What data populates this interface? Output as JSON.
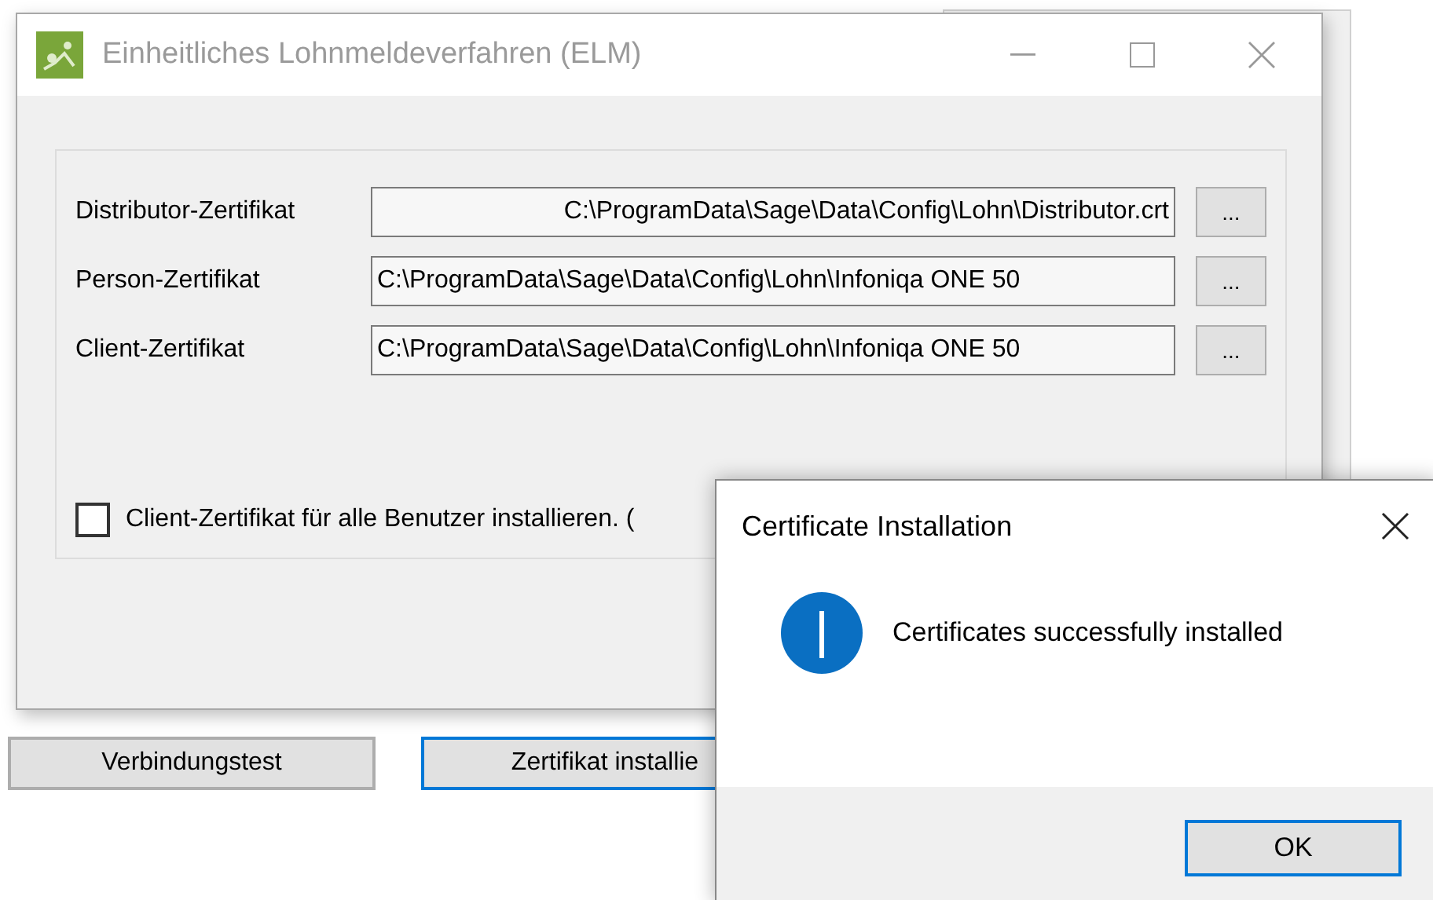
{
  "main_window": {
    "title": "Einheitliches Lohnmeldeverfahren (ELM)",
    "certificates": [
      {
        "label": "Distributor-Zertifikat",
        "value": "C:\\ProgramData\\Sage\\Data\\Config\\Lohn\\Distributor.crt",
        "kind": "right",
        "browse": "..."
      },
      {
        "label": "Person-Zertifikat",
        "value": "C:\\ProgramData\\Sage\\Data\\Config\\Lohn\\Infoniqa ONE 50",
        "kind": "left",
        "browse": "..."
      },
      {
        "label": "Client-Zertifikat",
        "value": "C:\\ProgramData\\Sage\\Data\\Config\\Lohn\\Infoniqa ONE 50",
        "kind": "left",
        "browse": "..."
      }
    ],
    "install_for_all": {
      "label": "Client-Zertifikat für alle Benutzer installieren. (",
      "checked": false
    }
  },
  "buttons": [
    {
      "label": "Verbindungstest",
      "focused": false
    },
    {
      "label": "Zertifikat installie",
      "focused": true
    }
  ],
  "dialog": {
    "title": "Certificate Installation",
    "message": "Certificates successfully installed",
    "ok": "OK"
  }
}
